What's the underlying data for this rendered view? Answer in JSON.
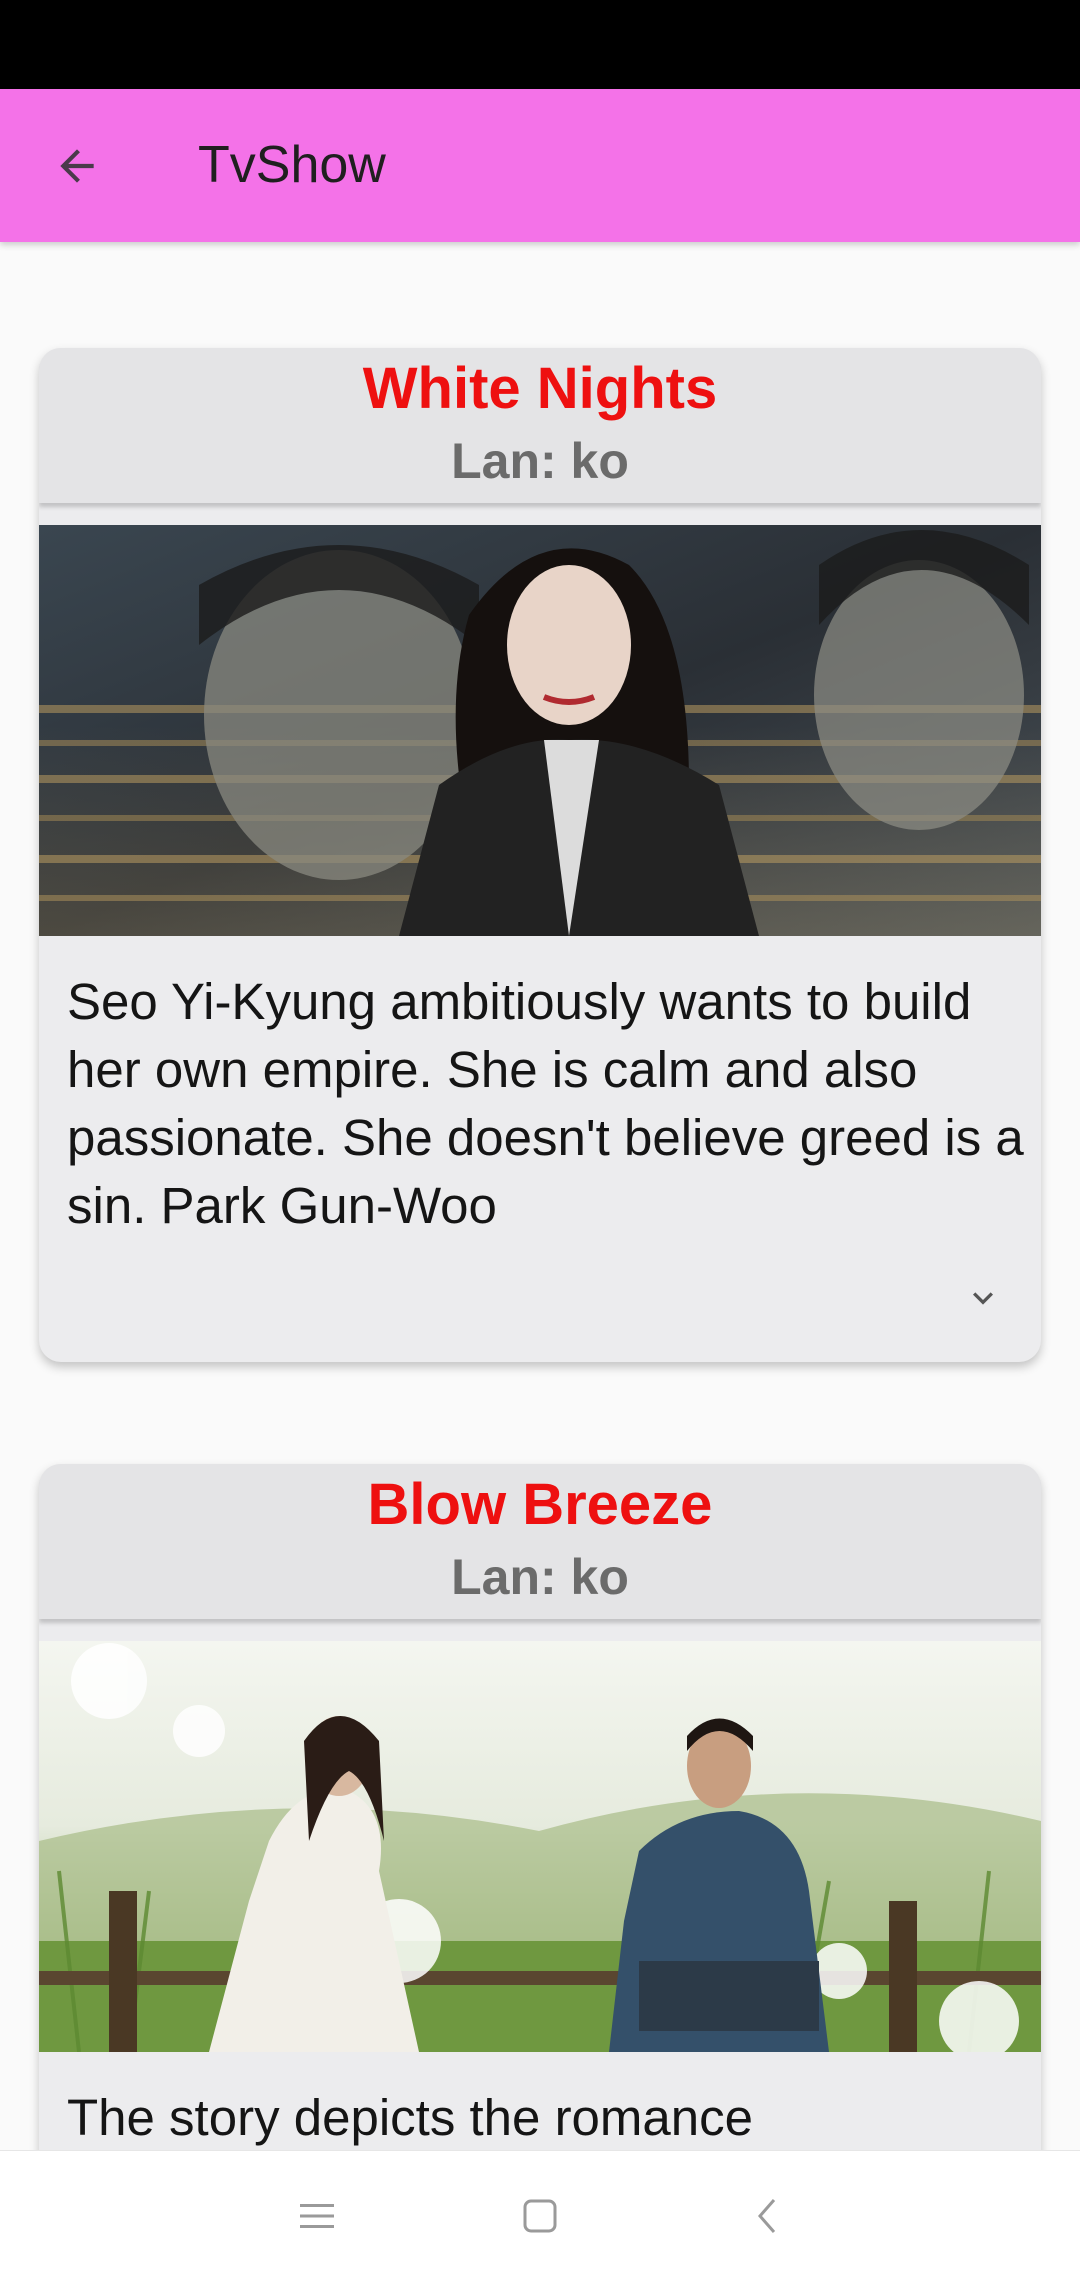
{
  "app_bar": {
    "title": "TvShow",
    "back_icon": "arrow-back-icon",
    "background": "#f472e8"
  },
  "shows": [
    {
      "title": "White Nights",
      "language": "Lan: ko",
      "image_alt": "Poster of three characters in front of a city skyline",
      "description": "Seo Yi-Kyung ambitiously wants to build her own empire. She is calm and also passionate. She doesn't believe greed is a sin. Park Gun-Woo",
      "expand_icon": "chevron-down-icon"
    },
    {
      "title": "Blow Breeze",
      "language": "Lan: ko",
      "image_alt": "Poster of a woman and a man sitting by a fence among dandelions",
      "description": "The story depicts the romance"
    }
  ],
  "colors": {
    "title": "#ee1010",
    "language": "#6b6b6b",
    "card": "#ececee"
  },
  "nav_bar": {
    "menu_icon": "menu-icon",
    "home_icon": "home-square-icon",
    "back_icon": "back-chevron-icon"
  }
}
